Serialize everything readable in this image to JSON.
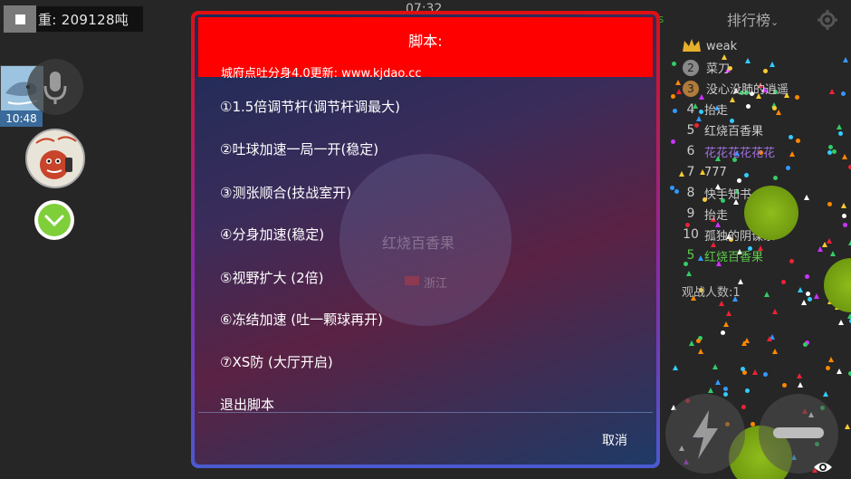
{
  "status": {
    "weight_text": "重: 209128吨",
    "clock": "07:32",
    "avatar_time": "10:48"
  },
  "leaderboard": {
    "title": "排行榜",
    "side_letter": "s",
    "rows": [
      {
        "rank": "",
        "name": "weak",
        "style": "crown"
      },
      {
        "rank": "2",
        "name": "菜刀",
        "style": "silver"
      },
      {
        "rank": "3",
        "name": "没心没肺的逍遥",
        "style": "bronze"
      },
      {
        "rank": "4",
        "name": "抬走",
        "style": "plain"
      },
      {
        "rank": "5",
        "name": "红烧百香果",
        "style": "plain"
      },
      {
        "rank": "6",
        "name": "花花花花花花",
        "style": "purple"
      },
      {
        "rank": "7",
        "name": "777",
        "style": "plain"
      },
      {
        "rank": "8",
        "name": "快手知书",
        "style": "plain"
      },
      {
        "rank": "9",
        "name": "抬走",
        "style": "plain"
      },
      {
        "rank": "10",
        "name": "孤独的阴谋家",
        "style": "plain"
      },
      {
        "rank": "5",
        "name": "红烧百香果",
        "style": "green"
      }
    ],
    "spectators": "观战人数:1"
  },
  "background": {
    "player_name": "红烧百香果",
    "flag_text": "浙江"
  },
  "modal": {
    "title": "脚本:",
    "subtitle": "城府点吐分身4.0更新: www.kjdao.cc",
    "items": [
      "①1.5倍调节杆(调节杆调最大)",
      "②吐球加速一局一开(稳定)",
      "③测张顺合(技战室开)",
      "④分身加速(稳定)",
      "⑤视野扩大 (2倍)",
      "⑥冻结加速 (吐一颗球再开)",
      "⑦XS防 (大厅开启)",
      "退出脚本"
    ],
    "cancel": "取消"
  },
  "colors": {
    "header_red": "#ff0000",
    "virus_green": "#8fbc1c",
    "leaderboard_green": "#5cc94a",
    "leaderboard_purple": "#a070e0"
  },
  "icons": [
    "checkbox-icon",
    "microphone-icon",
    "chevron-down-icon",
    "gear-icon",
    "crown-icon",
    "lightning-icon",
    "minus-icon",
    "eye-icon"
  ]
}
